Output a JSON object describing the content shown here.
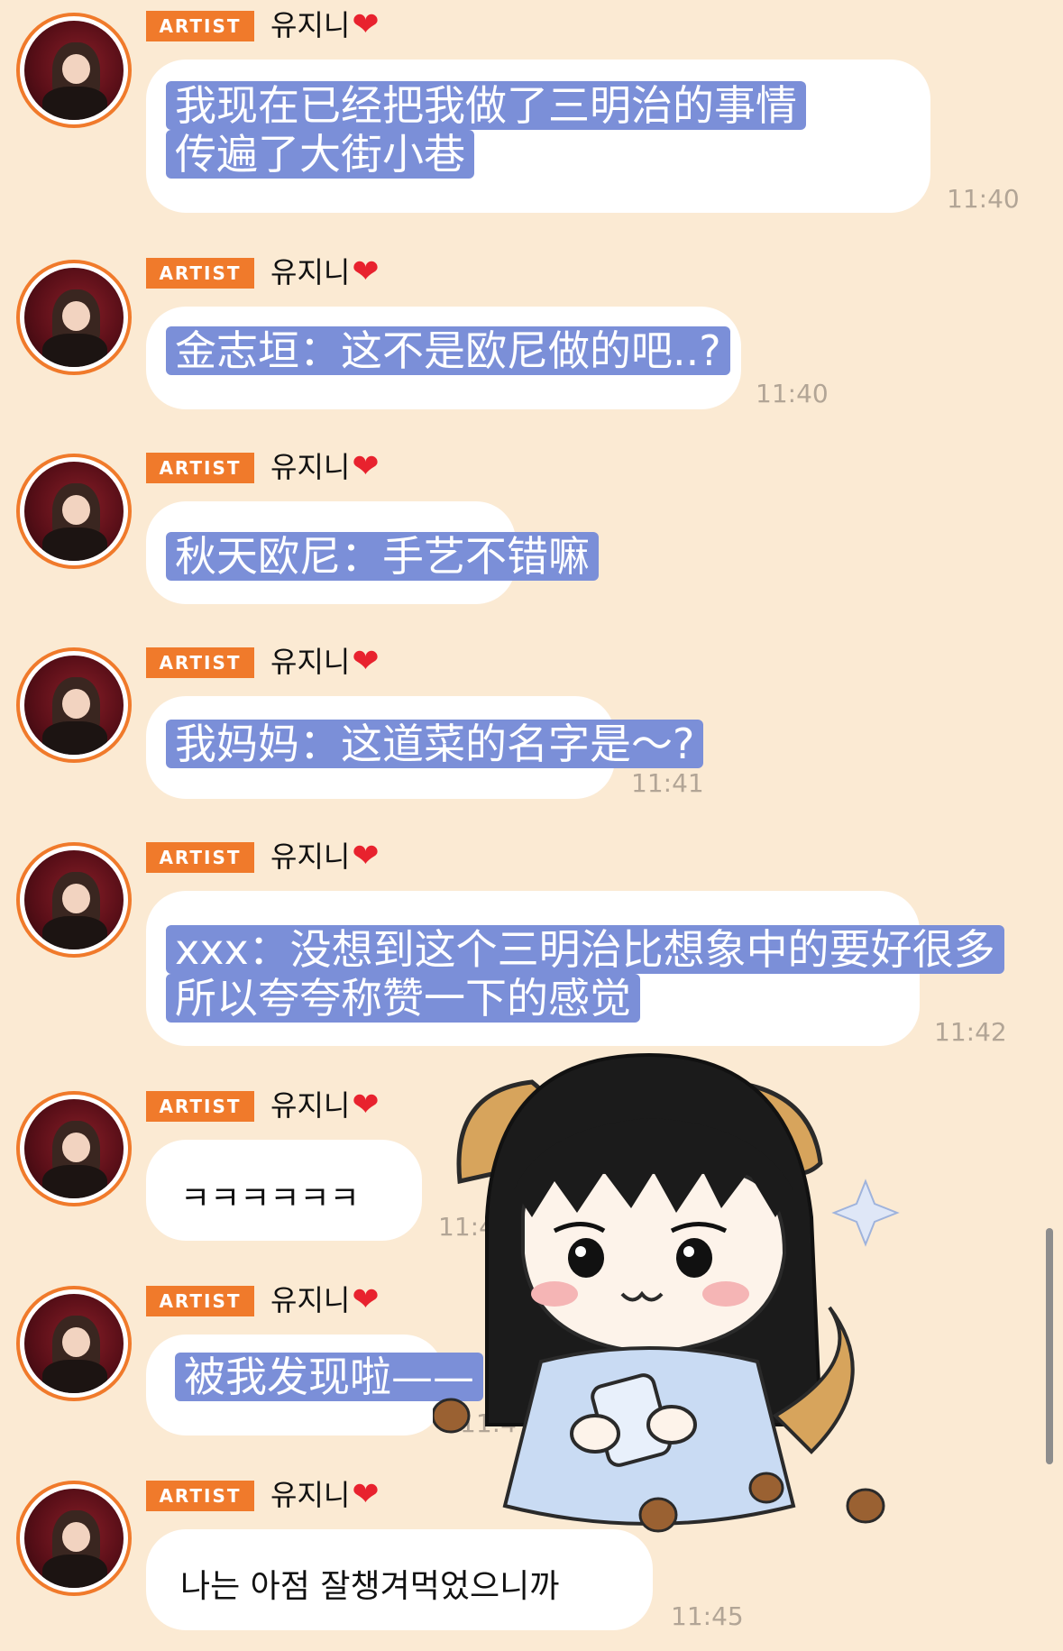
{
  "messages": [
    {
      "badge": "ARTIST",
      "user": "유지니",
      "heart": "❤",
      "text_lines": [
        "我现在已经把我做了三明治的事情",
        "传遍了大街小巷"
      ],
      "time": "11:40"
    },
    {
      "badge": "ARTIST",
      "user": "유지니",
      "heart": "❤",
      "text_lines": [
        "金志垣：这不是欧尼做的吧..?"
      ],
      "time": "11:40"
    },
    {
      "badge": "ARTIST",
      "user": "유지니",
      "heart": "❤",
      "text_lines": [
        "秋天欧尼：手艺不错嘛"
      ],
      "time": ""
    },
    {
      "badge": "ARTIST",
      "user": "유지니",
      "heart": "❤",
      "text_lines": [
        "我妈妈：这道菜的名字是～?"
      ],
      "time": "11:41"
    },
    {
      "badge": "ARTIST",
      "user": "유지니",
      "heart": "❤",
      "text_lines": [
        "xxx：没想到这个三明治比想象中的要好很多",
        "所以夸夸称赞一下的感觉"
      ],
      "time": "11:42"
    },
    {
      "badge": "ARTIST",
      "user": "유지니",
      "heart": "❤",
      "text_lines": [
        "ㅋㅋㅋㅋㅋㅋ"
      ],
      "time": "11:4"
    },
    {
      "badge": "ARTIST",
      "user": "유지니",
      "heart": "❤",
      "text_lines": [
        "被我发现啦——"
      ],
      "time": "11:4"
    },
    {
      "badge": "ARTIST",
      "user": "유지니",
      "heart": "❤",
      "text_lines": [
        "나는 아점 잘챙겨먹었으니까"
      ],
      "time": "11:45"
    }
  ],
  "sticker": {
    "icon": "girl-with-phone-sticker"
  },
  "colors": {
    "background": "#fbead3",
    "badge": "#f07a2b",
    "highlight": "#7b8fd8",
    "heart": "#e8222e"
  }
}
